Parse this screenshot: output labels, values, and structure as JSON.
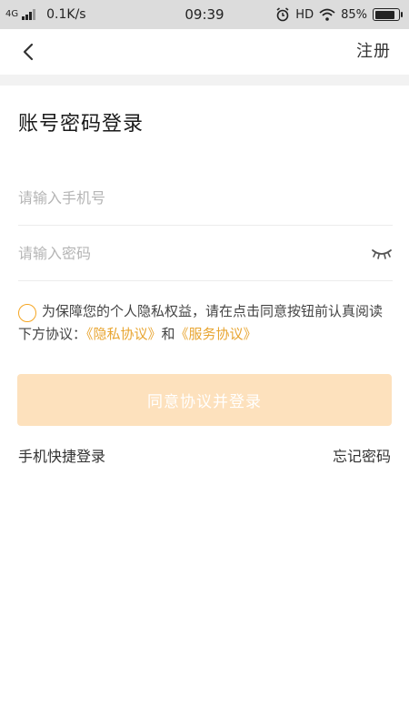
{
  "status_bar": {
    "network": "4G",
    "speed": "0.1K/s",
    "time": "09:39",
    "hd_label": "HD",
    "battery_level": "85%",
    "battery_fraction": 0.85
  },
  "nav": {
    "back_icon": "chevron-left-icon",
    "register_label": "注册"
  },
  "page_title": "账号密码登录",
  "phone_field": {
    "value": "",
    "placeholder": "请输入手机号"
  },
  "password_field": {
    "value": "",
    "placeholder": "请输入密码",
    "toggle_icon": "eye-closed-icon"
  },
  "agreement": {
    "checked": false,
    "prefix": "为保障您的个人隐私权益，请在点击同意按钮前认真阅读下方协议：",
    "privacy_link": "《隐私协议》",
    "joiner": "和",
    "service_link": "《服务协议》"
  },
  "login_button_label": "同意协议并登录",
  "links": {
    "sms_login": "手机快捷登录",
    "forgot_password": "忘记密码"
  },
  "colors": {
    "accent": "#f5a623",
    "link": "#e8a531",
    "button_disabled": "#fde1bd",
    "status_bar_bg": "#dcdcdc"
  }
}
